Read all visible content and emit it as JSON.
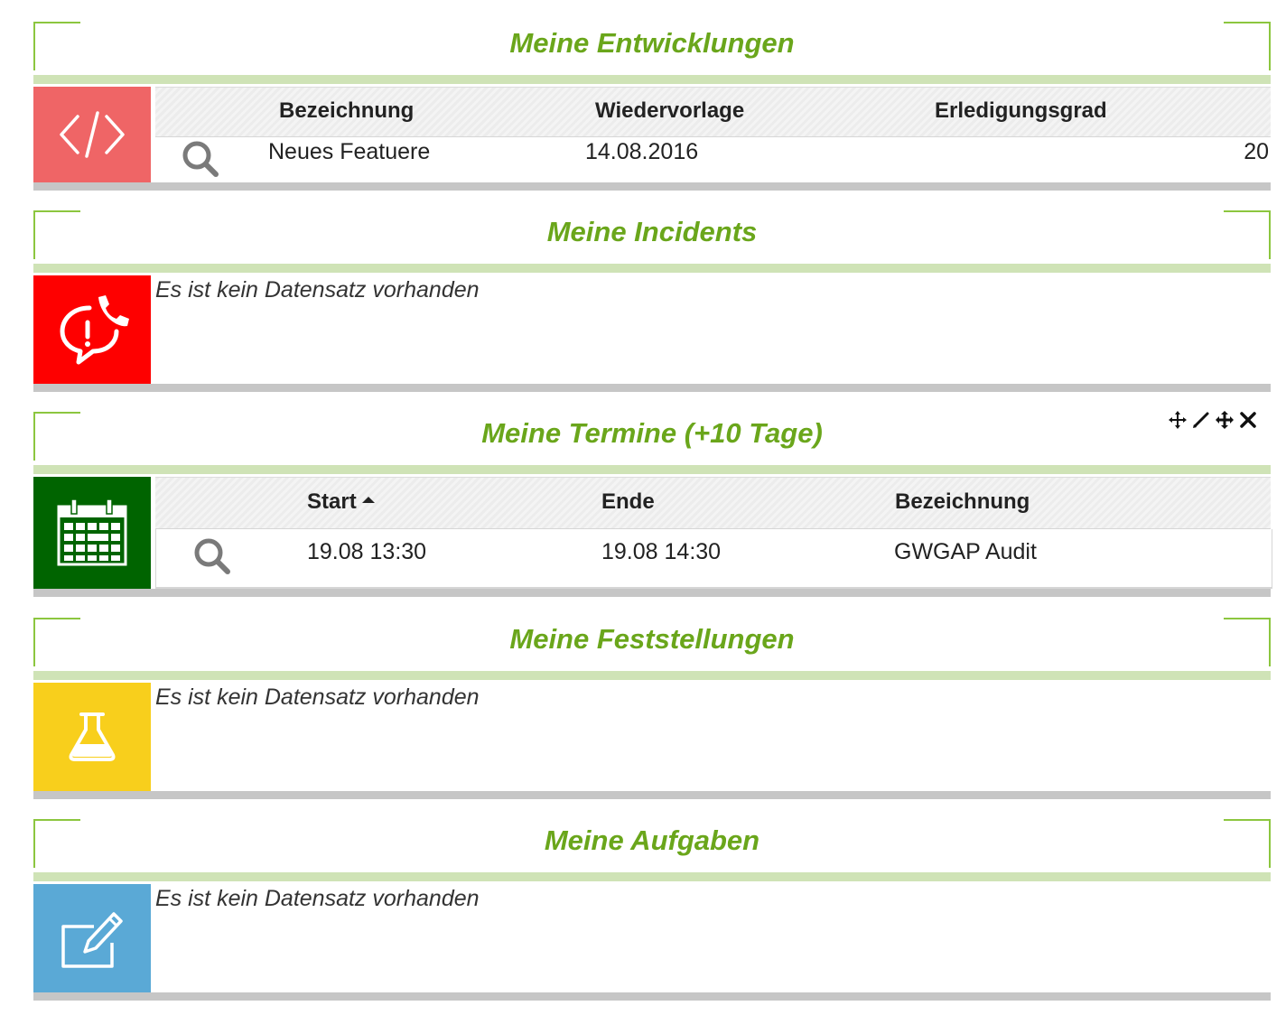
{
  "widgets": [
    {
      "title": "Meine Entwicklungen",
      "icon": "code-icon",
      "tile_color": "#ef6566",
      "columns": [
        "Bezeichnung",
        "Wiedervorlage",
        "Erledigungsgrad"
      ],
      "rows": [
        [
          "Neues Featuere",
          "14.08.2016",
          "20"
        ]
      ]
    },
    {
      "title": "Meine Incidents",
      "icon": "phone-alert-icon",
      "tile_color": "#fe0000",
      "empty_text": "Es ist kein Datensatz vorhanden"
    },
    {
      "title": "Meine Termine (+10 Tage)",
      "icon": "calendar-icon",
      "tile_color": "#006400",
      "columns": [
        "Start",
        "Ende",
        "Bezeichnung"
      ],
      "rows": [
        [
          "19.08 13:30",
          "19.08 14:30",
          "GWGAP Audit"
        ]
      ]
    },
    {
      "title": "Meine Feststellungen",
      "icon": "flask-icon",
      "tile_color": "#f8cf1c",
      "empty_text": "Es ist kein Datensatz vorhanden"
    },
    {
      "title": "Meine Aufgaben",
      "icon": "edit-icon",
      "tile_color": "#5aa9d6",
      "empty_text": "Es ist kein Datensatz vorhanden"
    }
  ],
  "colors": {
    "title_green": "#6aa61b",
    "corner_green": "#8cc63f",
    "stripe_green": "#cfe3b6",
    "bottom_gray": "#c6c6c6"
  },
  "widget_tools": [
    "move-icon",
    "edit-pencil-icon",
    "drag-icon",
    "close-icon"
  ]
}
